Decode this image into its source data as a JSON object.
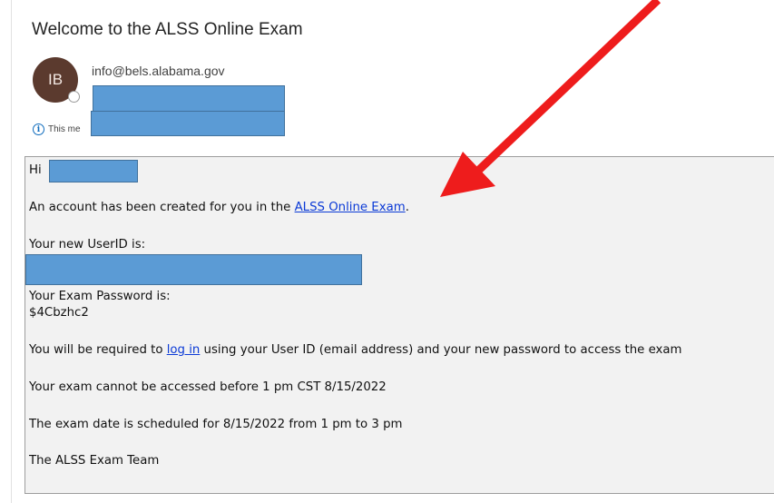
{
  "email": {
    "subject": "Welcome to the ALSS Online Exam",
    "avatar_initials": "IB",
    "sender": "info@bels.alabama.gov",
    "info_text": "This me"
  },
  "body": {
    "greeting": "Hi",
    "account_text": "An account has been created for you in the ",
    "account_link": "ALSS Online Exam",
    "account_after": ".",
    "userid_label": "Your new UserID is:",
    "password_label": "Your Exam Password is:",
    "password_value": "$4Cbzhc2",
    "login_before": "You will be required to ",
    "login_link": "log in",
    "login_after": " using your User ID (email address) and your new password to access the exam",
    "access_text": "Your exam cannot be accessed before 1 pm CST 8/15/2022",
    "schedule_text": "The exam date is scheduled for 8/15/2022 from 1 pm to 3 pm",
    "signature": "The ALSS Exam Team"
  },
  "colors": {
    "arrow": "#ee1c1c",
    "redaction": "#5b9bd5",
    "avatar": "#5b3a2e"
  }
}
